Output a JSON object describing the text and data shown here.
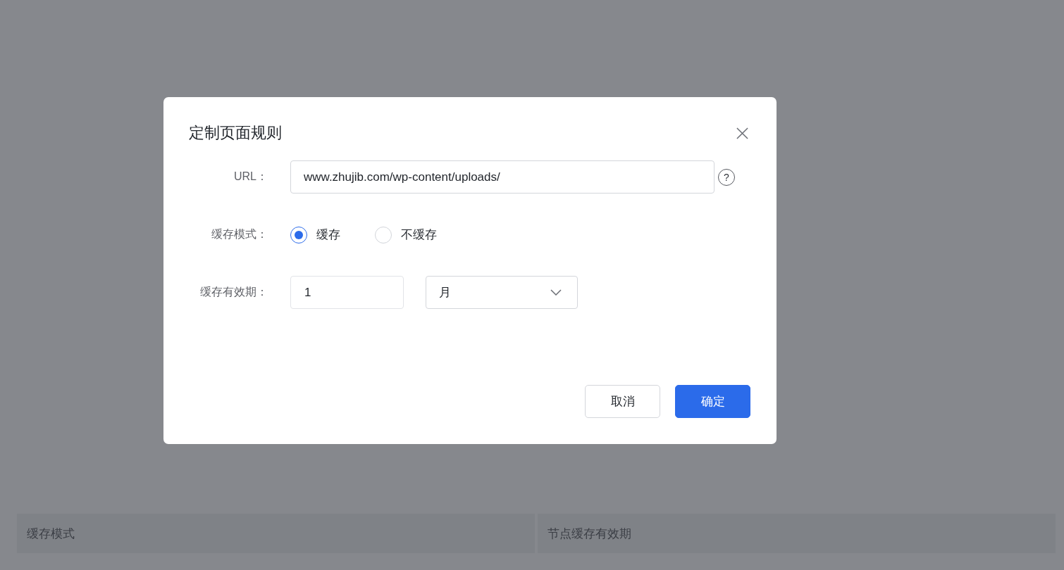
{
  "background_table": {
    "columns": [
      "缓存模式",
      "节点缓存有效期"
    ]
  },
  "dialog": {
    "title": "定制页面规则",
    "fields": [
      {
        "kind": "text",
        "label": "URL：",
        "value": "www.zhujib.com/wp-content/uploads/",
        "help": {
          "label": "?"
        }
      },
      {
        "kind": "radio",
        "label": "缓存模式：",
        "options": [
          {
            "label": "缓存",
            "selected": true
          },
          {
            "label": "不缓存",
            "selected": false
          }
        ]
      },
      {
        "kind": "duration",
        "label": "缓存有效期：",
        "value": "1",
        "unit": "月"
      }
    ],
    "buttons": [
      {
        "label": "取消",
        "kind": "secondary"
      },
      {
        "label": "确定",
        "kind": "primary"
      }
    ]
  }
}
